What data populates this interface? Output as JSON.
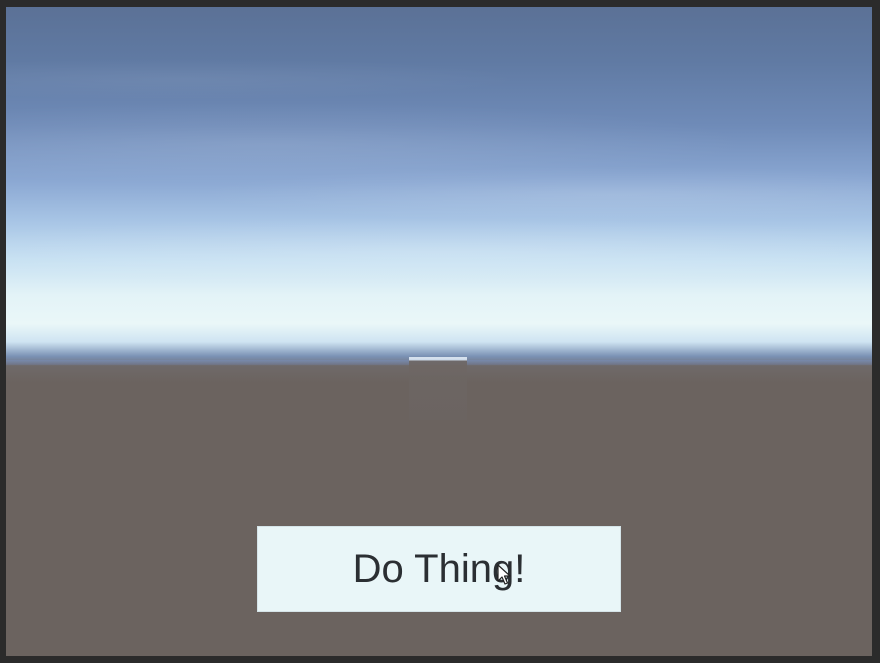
{
  "game": {
    "button": {
      "label": "Do Thing!"
    }
  },
  "colors": {
    "sky_top": "#5b7196",
    "horizon_glow": "#eaf7f8",
    "ground": "#6b635f",
    "button_background": "#e9f6f8",
    "button_text": "#2b2f33",
    "frame": "#2b2b2b"
  },
  "icons": {
    "cursor": "mouse-pointer-icon"
  }
}
